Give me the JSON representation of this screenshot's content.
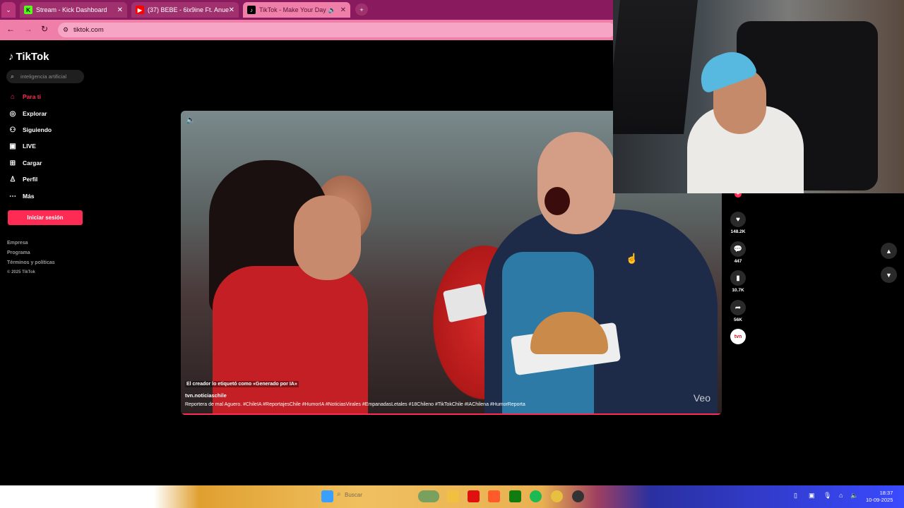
{
  "browser": {
    "tabs": [
      {
        "title": "Stream - Kick Dashboard",
        "favicon": "K"
      },
      {
        "title": "(37) BEBE - 6ix9ine Ft. Anuel AA",
        "favicon": "▶"
      },
      {
        "title": "TikTok - Make Your Day",
        "favicon": "♪"
      }
    ],
    "new_tab": "+",
    "url": "tiktok.com"
  },
  "tiktok": {
    "logo": "TikTok",
    "search_placeholder": "inteligencia artificial",
    "menu": [
      {
        "label": "Para ti",
        "icon": "home-icon",
        "active": true
      },
      {
        "label": "Explorar",
        "icon": "compass-icon"
      },
      {
        "label": "Siguiendo",
        "icon": "following-icon"
      },
      {
        "label": "LIVE",
        "icon": "live-icon"
      },
      {
        "label": "Cargar",
        "icon": "upload-icon"
      },
      {
        "label": "Perfil",
        "icon": "profile-icon"
      },
      {
        "label": "Más",
        "icon": "more-icon"
      }
    ],
    "login_button": "Iniciar sesión",
    "footer": [
      "Empresa",
      "Programa",
      "Términos y políticas",
      "© 2025 TikTok"
    ]
  },
  "video": {
    "ai_label": "El creador lo etiquetó como «Generado por IA»",
    "creator": "tvn.noticiaschile",
    "description": "Reportera de mal Aguero. #ChileIA #ReportajesChile #HumorIA #NoticiasVirales #EmpanadasLetales #18Chileno #TikTokChile #IAChilena #HumorReporta",
    "watermark": "Veo",
    "actions": {
      "likes": "148.2K",
      "comments": "447",
      "saves": "10.7K",
      "shares": "56K"
    }
  },
  "taskbar": {
    "search_label": "Buscar",
    "time": "18:37",
    "date": "10-09-2025"
  }
}
